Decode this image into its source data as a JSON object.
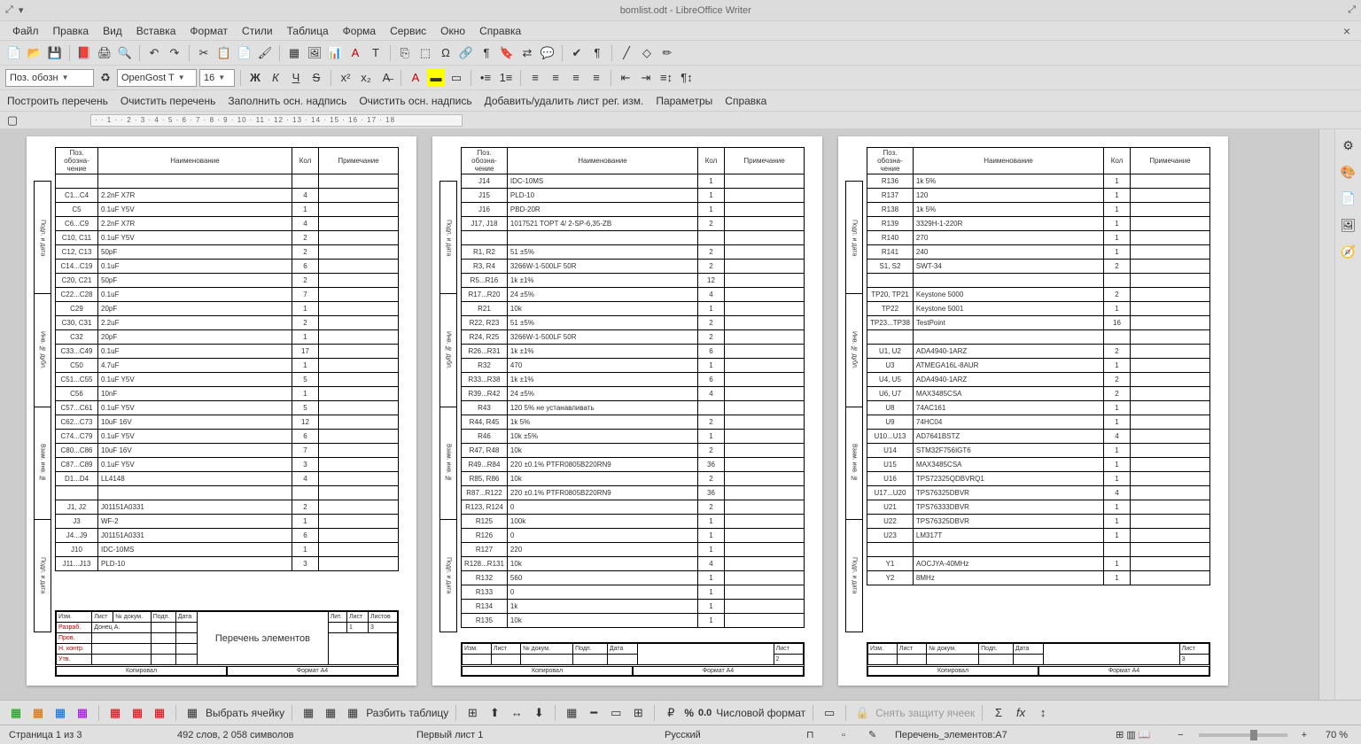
{
  "title": "bomlist.odt - LibreOffice Writer",
  "menu": [
    "Файл",
    "Правка",
    "Вид",
    "Вставка",
    "Формат",
    "Стили",
    "Таблица",
    "Форма",
    "Сервис",
    "Окно",
    "Справка"
  ],
  "styleCombo": "Поз. обозн",
  "fontCombo": "OpenGost T",
  "sizeCombo": "16",
  "row3": [
    "Построить перечень",
    "Очистить перечень",
    "Заполнить осн. надпись",
    "Очистить осн. надпись",
    "Добавить/удалить лист рег. изм.",
    "Параметры",
    "Справка"
  ],
  "rulerMarks": "· · 1 · · 2 · 3 · 4 · 5 · 6 · 7 · 8 · 9 · 10 · 11 · 12 · 13 · 14 · 15 · 16 · 17 · 18",
  "headers": {
    "pos": "Поз. обозна-чение",
    "name": "Наименование",
    "qty": "Кол",
    "note": "Примечание"
  },
  "sideLabels": [
    "Подп. и дата",
    "Инв. № дубл.",
    "Взам. инв. №",
    "Подп. и дата"
  ],
  "stampRow": [
    "Изм.",
    "Лист",
    "№ докум.",
    "Подп.",
    "Дата"
  ],
  "stamp1": {
    "razrab": "Разраб.",
    "razrabName": "Донец А.",
    "prov": "Пров.",
    "nkontr": "Н. контр.",
    "utv": "Утв.",
    "title": "Перечень элементов",
    "lit": "Лит.",
    "list": "Лист",
    "listov": "Листов",
    "listN": "1",
    "listovN": "3"
  },
  "stamp2": {
    "list": "Лист",
    "listN": "2"
  },
  "stamp3": {
    "list": "Лист",
    "listN": "3"
  },
  "foot": {
    "kopiroval": "Копировал",
    "format": "Формат  A4"
  },
  "bottomLabels": {
    "selectCell": "Выбрать ячейку",
    "splitTable": "Разбить таблицу",
    "numFormat": "Числовой формат",
    "unprotect": "Снять защиту ячеек",
    "zero": "0.0",
    "pct": "%"
  },
  "status": {
    "page": "Страница 1 из 3",
    "words": "492 слов, 2 058 символов",
    "sheet": "Первый лист 1",
    "lang": "Русский",
    "sel": "Перечень_элементов:A7",
    "zoom": "70 %"
  },
  "p1": [
    {
      "p": "",
      "n": "",
      "q": ""
    },
    {
      "p": "C1...C4",
      "n": "2.2nF X7R",
      "q": "4"
    },
    {
      "p": "C5",
      "n": "0.1uF Y5V",
      "q": "1"
    },
    {
      "p": "C6...C9",
      "n": "2.2nF X7R",
      "q": "4"
    },
    {
      "p": "C10, C11",
      "n": "0.1uF Y5V",
      "q": "2"
    },
    {
      "p": "C12, C13",
      "n": "50pF",
      "q": "2"
    },
    {
      "p": "C14...C19",
      "n": "0.1uF",
      "q": "6"
    },
    {
      "p": "C20, C21",
      "n": "50pF",
      "q": "2"
    },
    {
      "p": "C22...C28",
      "n": "0.1uF",
      "q": "7"
    },
    {
      "p": "C29",
      "n": "20pF",
      "q": "1"
    },
    {
      "p": "C30, C31",
      "n": "2.2uF",
      "q": "2"
    },
    {
      "p": "C32",
      "n": "20pF",
      "q": "1"
    },
    {
      "p": "C33...C49",
      "n": "0.1uF",
      "q": "17"
    },
    {
      "p": "C50",
      "n": "4.7uF",
      "q": "1"
    },
    {
      "p": "C51...C55",
      "n": "0.1uF Y5V",
      "q": "5"
    },
    {
      "p": "C56",
      "n": "10nF",
      "q": "1"
    },
    {
      "p": "C57...C61",
      "n": "0.1uF Y5V",
      "q": "5"
    },
    {
      "p": "C62...C73",
      "n": "10uF 16V",
      "q": "12"
    },
    {
      "p": "C74...C79",
      "n": "0.1uF Y5V",
      "q": "6"
    },
    {
      "p": "C80...C86",
      "n": "10uF 16V",
      "q": "7"
    },
    {
      "p": "C87...C89",
      "n": "0.1uF Y5V",
      "q": "3"
    },
    {
      "p": "D1...D4",
      "n": "LL4148",
      "q": "4"
    },
    {
      "p": "",
      "n": "",
      "q": ""
    },
    {
      "p": "J1, J2",
      "n": "J01151A0331",
      "q": "2"
    },
    {
      "p": "J3",
      "n": "WF-2",
      "q": "1"
    },
    {
      "p": "J4...J9",
      "n": "J01151A0331",
      "q": "6"
    },
    {
      "p": "J10",
      "n": "IDC-10MS",
      "q": "1"
    },
    {
      "p": "J11...J13",
      "n": "PLD-10",
      "q": "3"
    }
  ],
  "p2": [
    {
      "p": "J14",
      "n": "IDC-10MS",
      "q": "1"
    },
    {
      "p": "J15",
      "n": "PLD-10",
      "q": "1"
    },
    {
      "p": "J16",
      "n": "PBD-20R",
      "q": "1"
    },
    {
      "p": "J17, J18",
      "n": "1017521 TOPT 4/ 2-SP-6,35-ZB",
      "q": "2"
    },
    {
      "p": "",
      "n": "",
      "q": ""
    },
    {
      "p": "R1, R2",
      "n": "51 ±5%",
      "q": "2"
    },
    {
      "p": "R3, R4",
      "n": "3266W-1-500LF 50R",
      "q": "2"
    },
    {
      "p": "R5...R16",
      "n": "1k ±1%",
      "q": "12"
    },
    {
      "p": "R17...R20",
      "n": "24 ±5%",
      "q": "4"
    },
    {
      "p": "R21",
      "n": "10k",
      "q": "1"
    },
    {
      "p": "R22, R23",
      "n": "51 ±5%",
      "q": "2"
    },
    {
      "p": "R24, R25",
      "n": "3266W-1-500LF 50R",
      "q": "2"
    },
    {
      "p": "R26...R31",
      "n": "1k ±1%",
      "q": "6"
    },
    {
      "p": "R32",
      "n": "470",
      "q": "1"
    },
    {
      "p": "R33...R38",
      "n": "1k ±1%",
      "q": "6"
    },
    {
      "p": "R39...R42",
      "n": "24 ±5%",
      "q": "4"
    },
    {
      "p": "R43",
      "n": "120 5% не устанавливать",
      "q": ""
    },
    {
      "p": "R44, R45",
      "n": "1k 5%",
      "q": "2"
    },
    {
      "p": "R46",
      "n": "10k ±5%",
      "q": "1"
    },
    {
      "p": "R47, R48",
      "n": "10k",
      "q": "2"
    },
    {
      "p": "R49...R84",
      "n": "220 ±0.1% PTFR0805B220RN9",
      "q": "36"
    },
    {
      "p": "R85, R86",
      "n": "10k",
      "q": "2"
    },
    {
      "p": "R87...R122",
      "n": "220 ±0.1% PTFR0805B220RN9",
      "q": "36"
    },
    {
      "p": "R123, R124",
      "n": "0",
      "q": "2"
    },
    {
      "p": "R125",
      "n": "100k",
      "q": "1"
    },
    {
      "p": "R126",
      "n": "0",
      "q": "1"
    },
    {
      "p": "R127",
      "n": "220",
      "q": "1"
    },
    {
      "p": "R128...R131",
      "n": "10k",
      "q": "4"
    },
    {
      "p": "R132",
      "n": "560",
      "q": "1"
    },
    {
      "p": "R133",
      "n": "0",
      "q": "1"
    },
    {
      "p": "R134",
      "n": "1k",
      "q": "1"
    },
    {
      "p": "R135",
      "n": "10k",
      "q": "1"
    }
  ],
  "p3": [
    {
      "p": "R136",
      "n": "1k 5%",
      "q": "1"
    },
    {
      "p": "R137",
      "n": "120",
      "q": "1"
    },
    {
      "p": "R138",
      "n": "1k 5%",
      "q": "1"
    },
    {
      "p": "R139",
      "n": "3329H-1-220R",
      "q": "1"
    },
    {
      "p": "R140",
      "n": "270",
      "q": "1"
    },
    {
      "p": "R141",
      "n": "240",
      "q": "1"
    },
    {
      "p": "S1, S2",
      "n": "SWT-34",
      "q": "2"
    },
    {
      "p": "",
      "n": "",
      "q": ""
    },
    {
      "p": "TP20, TP21",
      "n": "Keystone 5000",
      "q": "2"
    },
    {
      "p": "TP22",
      "n": "Keystone 5001",
      "q": "1"
    },
    {
      "p": "TP23...TP38",
      "n": "TestPoint",
      "q": "16"
    },
    {
      "p": "",
      "n": "",
      "q": ""
    },
    {
      "p": "U1, U2",
      "n": "ADA4940-1ARZ",
      "q": "2"
    },
    {
      "p": "U3",
      "n": "ATMEGA16L-8AUR",
      "q": "1"
    },
    {
      "p": "U4, U5",
      "n": "ADA4940-1ARZ",
      "q": "2"
    },
    {
      "p": "U6, U7",
      "n": "MAX3485CSA",
      "q": "2"
    },
    {
      "p": "U8",
      "n": "74AC161",
      "q": "1"
    },
    {
      "p": "U9",
      "n": "74HC04",
      "q": "1"
    },
    {
      "p": "U10...U13",
      "n": "AD7641BSTZ",
      "q": "4"
    },
    {
      "p": "U14",
      "n": "STM32F756IGT6",
      "q": "1"
    },
    {
      "p": "U15",
      "n": "MAX3485CSA",
      "q": "1"
    },
    {
      "p": "U16",
      "n": "TPS72325QDBVRQ1",
      "q": "1"
    },
    {
      "p": "U17...U20",
      "n": "TPS76325DBVR",
      "q": "4"
    },
    {
      "p": "U21",
      "n": "TPS76333DBVR",
      "q": "1"
    },
    {
      "p": "U22",
      "n": "TPS76325DBVR",
      "q": "1"
    },
    {
      "p": "U23",
      "n": "LM317T",
      "q": "1"
    },
    {
      "p": "",
      "n": "",
      "q": ""
    },
    {
      "p": "Y1",
      "n": "AOCJYA-40MHz",
      "q": "1"
    },
    {
      "p": "Y2",
      "n": "8MHz",
      "q": "1"
    }
  ]
}
